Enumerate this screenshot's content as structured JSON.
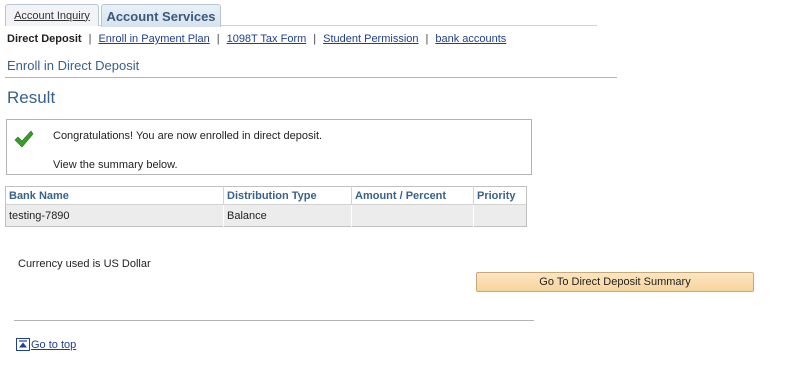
{
  "tabs": [
    {
      "label": "Account Inquiry",
      "active": false
    },
    {
      "label": "Account Services",
      "active": true
    }
  ],
  "subnav": {
    "current": "Direct Deposit",
    "links": [
      "Enroll in Payment Plan",
      "1098T Tax Form",
      "Student Permission",
      "bank accounts"
    ]
  },
  "page_title": "Enroll in Direct Deposit",
  "result_heading": "Result",
  "message": {
    "icon": "checkmark-icon",
    "line1": "Congratulations! You are now enrolled in direct deposit.",
    "line2": "View the summary below."
  },
  "grid": {
    "columns": [
      "Bank Name",
      "Distribution Type",
      "Amount / Percent",
      "Priority"
    ],
    "rows": [
      [
        "testing-7890",
        "Balance",
        "",
        ""
      ]
    ]
  },
  "currency_text": "Currency used is US Dollar",
  "summary_button": "Go To Direct Deposit Summary",
  "go_top": {
    "icon": "go-to-top-icon",
    "label": "Go to top"
  },
  "colors": {
    "accent": "#38618c",
    "link": "#1f3f8f",
    "button": "#f7d49c",
    "check": "#3a9a2a"
  }
}
